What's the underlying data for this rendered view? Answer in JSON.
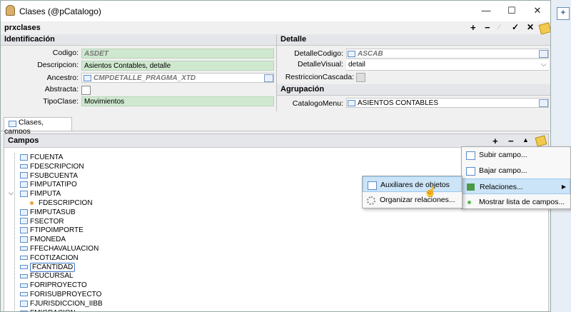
{
  "window": {
    "title": "Clases (@pCatalogo)",
    "form_name": "prxclases"
  },
  "toolbar": [
    "+",
    "−",
    "⁄",
    "✓",
    "✕"
  ],
  "identificacion": {
    "header": "Identificación",
    "codigo_label": "Codigo:",
    "codigo_value": "ASDET",
    "descripcion_label": "Descripcion:",
    "descripcion_value": "Asientos Contables, detalle",
    "ancestro_label": "Ancestro:",
    "ancestro_value": "CMPDETALLE_PRAGMA_XTD",
    "abstracta_label": "Abstracta:",
    "tipoclase_label": "TipoClase:",
    "tipoclase_value": "Movimientos"
  },
  "detalle": {
    "header": "Detalle",
    "detallecodigo_label": "DetalleCodigo:",
    "detallecodigo_value": "ASCAB",
    "detallevisual_label": "DetalleVisual:",
    "detallevisual_value": "detail",
    "restriccion_label": "RestriccionCascada:"
  },
  "agrupacion": {
    "header": "Agrupación",
    "catalogo_label": "CatalogoMenu:",
    "catalogo_value": "ASIENTOS CONTABLES"
  },
  "tab": {
    "label": "Clases, campos"
  },
  "campos": {
    "header": "Campos"
  },
  "tree": [
    "FCUENTA",
    "FDESCRIPCION",
    "FSUBCUENTA",
    "FIMPUTATIPO",
    "FIMPUTA",
    "FDESCRIPCION",
    "FIMPUTASUB",
    "FSECTOR",
    "FTIPOIMPORTE",
    "FMONEDA",
    "FFECHAVALUACION",
    "FCOTIZACION",
    "FCANTIDAD",
    "FSUCURSAL",
    "FORIPROYECTO",
    "FORISUBPROYECTO",
    "FJURISDICCION_IIBB",
    "FMIGRACION"
  ],
  "context_menu": [
    "Subir campo...",
    "Bajar campo...",
    "Relaciones...",
    "Mostrar lista de campos..."
  ],
  "submenu": [
    "Auxiliares de objetos",
    "Organizar relaciones..."
  ],
  "colors": {
    "green_field": "#cfe8cf",
    "highlight": "#cce4f7"
  }
}
